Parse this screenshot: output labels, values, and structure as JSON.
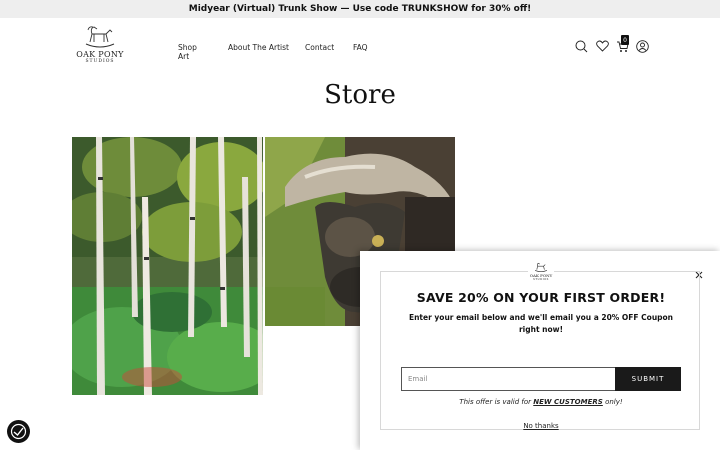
{
  "announcement": "Midyear (Virtual) Trunk Show — Use code TRUNKSHOW for 30% off!",
  "logo": {
    "main": "OAK PONY",
    "sub": "STUDIOS"
  },
  "nav": {
    "shop": "Shop Art",
    "about": "About The Artist",
    "contact": "Contact",
    "faq": "FAQ"
  },
  "header_icons": [
    "search-icon",
    "heart-icon",
    "cart-icon",
    "account-icon"
  ],
  "cart": {
    "count": "0"
  },
  "page": {
    "title": "Store"
  },
  "popup": {
    "heading": "SAVE 20% ON YOUR FIRST ORDER!",
    "subtext": "Enter your email below and we'll email you a 20% OFF Coupon right now!",
    "email_placeholder": "Email",
    "submit_label": "SUBMIT",
    "offer_prefix": "This offer is valid for",
    "offer_emphasis": "NEW CUSTOMERS",
    "offer_suffix": "only!",
    "no_thanks": "No thanks"
  },
  "colors": {
    "dark": "#1a1a1a",
    "announcement_bg": "#eeeeee"
  }
}
